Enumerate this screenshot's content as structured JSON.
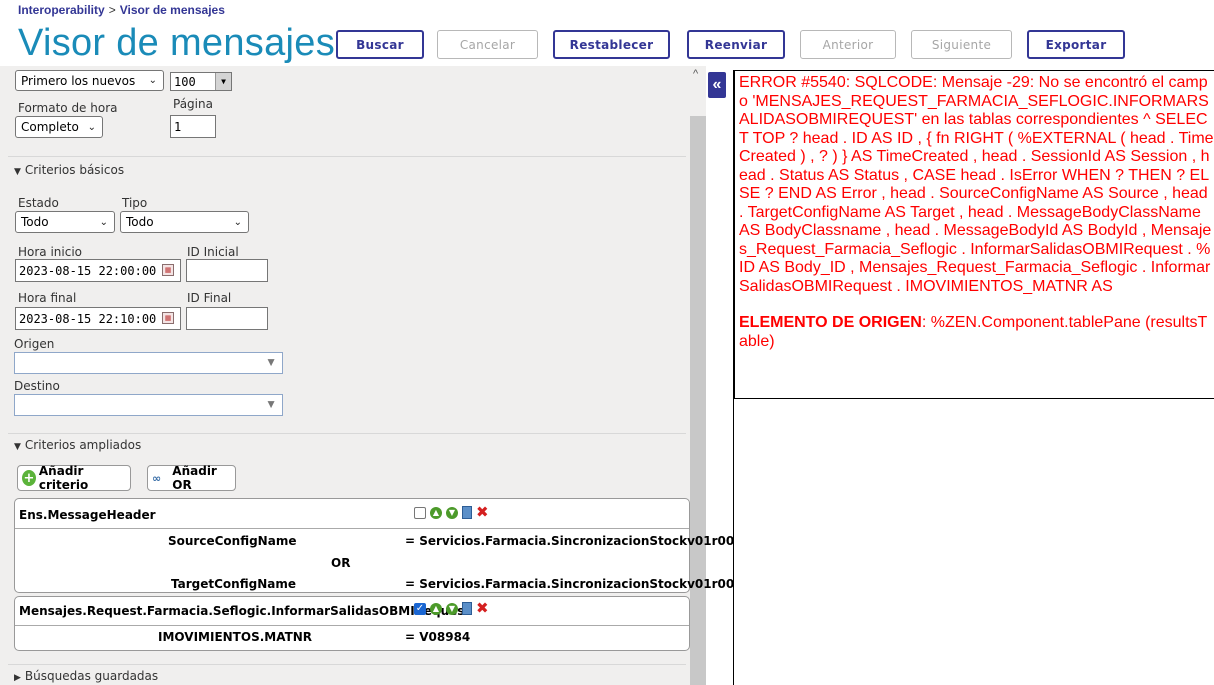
{
  "breadcrumb": {
    "root": "Interoperability",
    "separator": ">",
    "current": "Visor de mensajes"
  },
  "title": "Visor de mensajes",
  "toolbar": {
    "buscar": "Buscar",
    "cancelar": "Cancelar",
    "restablecer": "Restablecer",
    "reenviar": "Reenviar",
    "anterior": "Anterior",
    "siguiente": "Siguiente",
    "exportar": "Exportar"
  },
  "form": {
    "sort_value": "Primero los nuevos",
    "page_size_value": "100",
    "time_format_label": "Formato de hora",
    "time_format_value": "Completo",
    "page_label": "Página",
    "page_value": "1"
  },
  "basic": {
    "header": "Criterios básicos",
    "estado_label": "Estado",
    "estado_value": "Todo",
    "tipo_label": "Tipo",
    "tipo_value": "Todo",
    "hora_inicio_label": "Hora inicio",
    "hora_inicio_value": "2023-08-15 22:00:00",
    "id_inicial_label": "ID Inicial",
    "id_inicial_value": "",
    "hora_final_label": "Hora final",
    "hora_final_value": "2023-08-15 22:10:00",
    "id_final_label": "ID Final",
    "id_final_value": "",
    "origen_label": "Origen",
    "destino_label": "Destino"
  },
  "extended": {
    "header": "Criterios ampliados",
    "add_criterion": "Añadir criterio",
    "add_or": "Añadir OR",
    "group1": {
      "title": "Ens.MessageHeader",
      "row1_field": "SourceConfigName",
      "row1_value": "= Servicios.Farmacia.SincronizacionStockv01r00",
      "or_label": "OR",
      "row2_field": "TargetConfigName",
      "row2_value": "= Servicios.Farmacia.SincronizacionStockv01r00"
    },
    "group2": {
      "title": "Mensajes.Request.Farmacia.Seflogic.InformarSalidasOBMIRequest",
      "row1_field": "IMOVIMIENTOS.MATNR",
      "row1_value": "= V08984"
    }
  },
  "saved": {
    "header": "Búsquedas guardadas"
  },
  "collapse_glyph": "«",
  "error": {
    "message": "ERROR #5540: SQLCODE: Mensaje -29: No se encontró el campo 'MENSAJES_REQUEST_FARMACIA_SEFLOGIC.INFORMARSALIDASOBMIREQUEST' en las tablas correspondientes ^ SELECT TOP ? head . ID AS ID , { fn RIGHT ( %EXTERNAL ( head . TimeCreated ) , ? ) } AS TimeCreated , head . SessionId AS Session , head . Status AS Status , CASE head . IsError WHEN ? THEN ? ELSE ? END AS Error , head . SourceConfigName AS Source , head . TargetConfigName AS Target , head . MessageBodyClassName AS BodyClassname , head . MessageBodyId AS BodyId , Mensajes_Request_Farmacia_Seflogic . InformarSalidasOBMIRequest . %ID AS Body_ID , Mensajes_Request_Farmacia_Seflogic . InformarSalidasOBMIRequest . IMOVIMIENTOS_MATNR AS",
    "origin_label": "ELEMENTO DE ORIGEN",
    "origin_value": ": %ZEN.Component.tablePane (resultsTable)"
  }
}
